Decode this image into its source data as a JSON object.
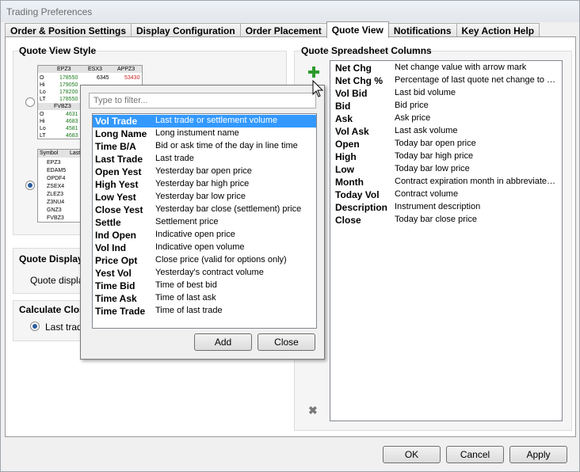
{
  "window": {
    "title": "Trading Preferences"
  },
  "tabs": [
    {
      "label": "Order & Position Settings"
    },
    {
      "label": "Display Configuration"
    },
    {
      "label": "Order Placement"
    },
    {
      "label": "Quote View",
      "active": true
    },
    {
      "label": "Notifications"
    },
    {
      "label": "Key Action Help"
    }
  ],
  "quote_view_style": {
    "title": "Quote View Style",
    "preview1": {
      "header": [
        "EPZ3",
        "ESX3",
        "APPZ3"
      ],
      "rows": [
        {
          "label": "O",
          "v1": "178550",
          "v2": "6345",
          "v3": "53430"
        },
        {
          "label": "Hi",
          "v1": "179050",
          "v2": "6347",
          "v3": "53431"
        },
        {
          "label": "Lo",
          "v1": "178200",
          "v2": "6340",
          "v3": "53420"
        },
        {
          "label": "LT",
          "v1": "178550",
          "v2": "6345",
          "v3": "53430"
        }
      ],
      "header2": [
        "FVBZ3"
      ],
      "rows2": [
        {
          "label": "O",
          "v1": "4631"
        },
        {
          "label": "Hi",
          "v1": "4683"
        },
        {
          "label": "Lo",
          "v1": "4581"
        },
        {
          "label": "LT",
          "v1": "4683"
        }
      ]
    },
    "preview2": {
      "header": [
        "Symbol",
        "Last"
      ],
      "symbols": [
        "EPZ3",
        "EDAM5",
        "OPDF4",
        "ZSEX4",
        "ZLEZ3",
        "Z3NU4",
        "GNZ3",
        "FVBZ3"
      ]
    }
  },
  "quote_display": {
    "title": "Quote Display",
    "label": "Quote display"
  },
  "calculate_close": {
    "title": "Calculate Clos",
    "option": "Last trad"
  },
  "spreadsheet": {
    "title": "Quote Spreadsheet Columns",
    "columns": [
      {
        "key": "Net Chg",
        "desc": "Net change value with arrow mark"
      },
      {
        "key": "Net Chg %",
        "desc": "Percentage of last quote net change to previous close"
      },
      {
        "key": "Vol Bid",
        "desc": "Last bid volume"
      },
      {
        "key": "Bid",
        "desc": "Bid price"
      },
      {
        "key": "Ask",
        "desc": "Ask price"
      },
      {
        "key": "Vol Ask",
        "desc": "Last ask volume"
      },
      {
        "key": "Open",
        "desc": "Today bar open price"
      },
      {
        "key": "High",
        "desc": "Today bar high price"
      },
      {
        "key": "Low",
        "desc": "Today bar low price"
      },
      {
        "key": "Month",
        "desc": "Contract expiration month in abbreviated form"
      },
      {
        "key": "Today Vol",
        "desc": "Contract volume"
      },
      {
        "key": "Description",
        "desc": "Instrument description"
      },
      {
        "key": "Close",
        "desc": "Today bar close price"
      }
    ]
  },
  "popup": {
    "filter_placeholder": "Type to filter...",
    "items": [
      {
        "key": "Vol Trade",
        "desc": "Last trade or settlement volume",
        "selected": true
      },
      {
        "key": "Long Name",
        "desc": "Long instument name"
      },
      {
        "key": "Time B/A",
        "desc": "Bid or ask time of the day in line time"
      },
      {
        "key": "Last Trade",
        "desc": "Last trade"
      },
      {
        "key": "Open Yest",
        "desc": "Yesterday bar open price"
      },
      {
        "key": "High Yest",
        "desc": "Yesterday bar high price"
      },
      {
        "key": "Low Yest",
        "desc": "Yesterday bar low price"
      },
      {
        "key": "Close Yest",
        "desc": "Yesterday bar close (settlement) price"
      },
      {
        "key": "Settle",
        "desc": "Settlement price"
      },
      {
        "key": "Ind Open",
        "desc": "Indicative open price"
      },
      {
        "key": "Vol Ind",
        "desc": "Indicative open volume"
      },
      {
        "key": "Price Opt",
        "desc": "Close price (valid for options only)"
      },
      {
        "key": "Yest Vol",
        "desc": "Yesterday's contract volume"
      },
      {
        "key": "Time Bid",
        "desc": "Time of best bid"
      },
      {
        "key": "Time Ask",
        "desc": "Time of last ask"
      },
      {
        "key": "Time Trade",
        "desc": "Time of last trade"
      }
    ],
    "add_label": "Add",
    "close_label": "Close"
  },
  "footer": {
    "ok": "OK",
    "cancel": "Cancel",
    "apply": "Apply"
  },
  "colors": {
    "selection": "#3399ff",
    "plus": "#2e9a2e",
    "up": "#1a7a1a",
    "down": "#d02020"
  }
}
